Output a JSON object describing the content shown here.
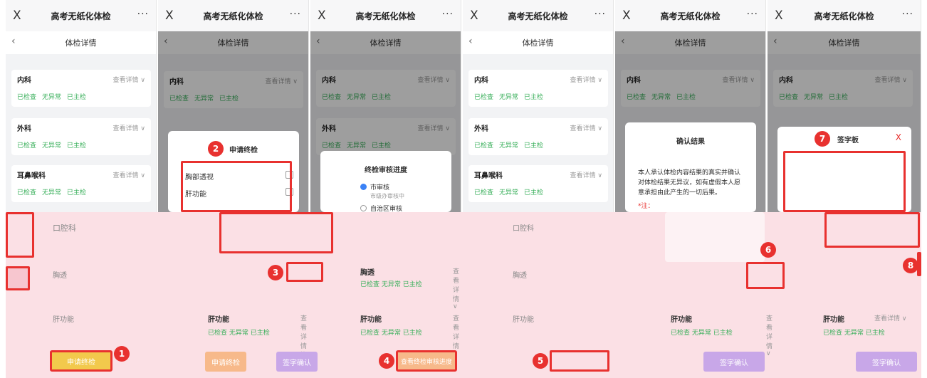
{
  "app": {
    "close": "X",
    "title": "高考无纸化体检",
    "more": "···"
  },
  "subheader": {
    "back": "‹",
    "title": "体检详情"
  },
  "item_status": [
    "已检查",
    "无异常",
    "已主检"
  ],
  "items": {
    "neike": "内科",
    "waike": "外科",
    "erbi": "耳鼻喉科",
    "kouqiang": "口腔科",
    "xiongtou": "胸透",
    "gan": "肝功能"
  },
  "detail_label": "查看详情 ∨",
  "dialog_apply": {
    "title": "申请终检",
    "options": [
      "胸部透视",
      "肝功能"
    ]
  },
  "dialog_progress": {
    "title": "终检审核进度",
    "steps": [
      {
        "name": "市审核",
        "sub": "市级办审核中"
      },
      {
        "name": "自治区审核",
        "sub": ""
      }
    ]
  },
  "dialog_confirm": {
    "title": "确认结果",
    "body": "本人承认体检内容结果的真实并确认对体检结果无异议，如有虚假本人愿意承担由此产生的一切后果。",
    "note": "*注："
  },
  "dialog_sign": {
    "title": "签字板",
    "close": "X"
  },
  "buttons": {
    "apply": "申请终检",
    "view_progress": "查看终检审核进度",
    "sign_confirm": "签字确认"
  },
  "steps": [
    "1",
    "2",
    "3",
    "4",
    "5",
    "6",
    "7",
    "8"
  ],
  "colors": {
    "green": "#3bb05c",
    "red": "#e8312f",
    "yellow": "#f2c94c",
    "purple": "#c8a7e8",
    "orange": "#f7b98a"
  }
}
